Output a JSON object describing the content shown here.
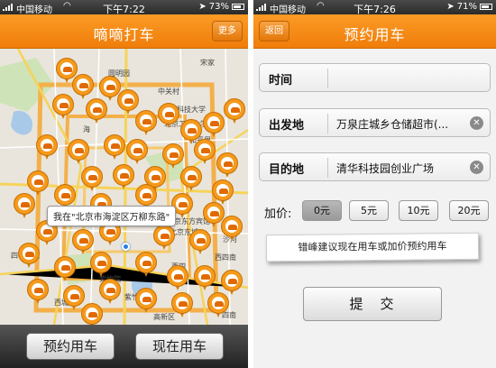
{
  "colors": {
    "accent": "#f39012",
    "map_bg": "#e9e5dc"
  },
  "left": {
    "status": {
      "carrier": "中国移动",
      "time": "下午7:22",
      "battery": "73%"
    },
    "title": "嘀嘀打车",
    "more_button": "更多",
    "map": {
      "callout": "我在\"北京市海淀区万柳东路\"",
      "labels": {
        "top": "宋家",
        "l1": "圆明园",
        "l2": "中关村",
        "l3": "电子科技大学",
        "l4": "北京工业大学",
        "l5": "和平里",
        "l6": "光",
        "l7": "北京东方宾馆",
        "l8": "北京东城",
        "l9": "沙河",
        "l10": "四季青镇",
        "l11": "西四",
        "l12": "西四南",
        "l13": "西城区",
        "l14": "紫竹院",
        "l15": "高新区",
        "l16": "海",
        "l17": "四南",
        "l18": "紫竹院"
      }
    },
    "buttons": {
      "reserve": "预约用车",
      "now": "现在用车"
    }
  },
  "right": {
    "status": {
      "carrier": "中国移动",
      "time": "下午7:26",
      "battery": "71%"
    },
    "title": "预约用车",
    "back_button": "返回",
    "fields": {
      "time": {
        "label": "时间",
        "value": ""
      },
      "origin": {
        "label": "出发地",
        "value": "万泉庄城乡仓储超市(..."
      },
      "destination": {
        "label": "目的地",
        "value": "清华科技园创业广场"
      }
    },
    "add_price": {
      "label": "加价:",
      "options": [
        "0元",
        "5元",
        "10元",
        "20元"
      ],
      "selected": "0元"
    },
    "tip": "错峰建议现在用车或加价预约用车",
    "submit": "提　交"
  }
}
